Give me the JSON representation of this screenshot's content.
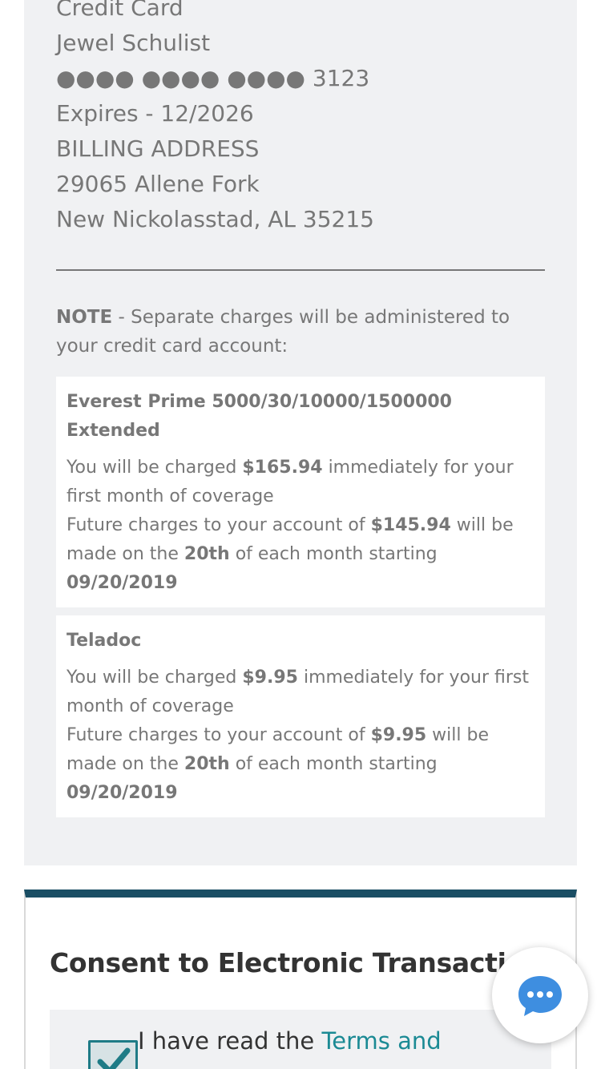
{
  "payment": {
    "method": "Credit Card",
    "name": "Jewel Schulist",
    "card_masked": "●●●● ●●●● ●●●● 3123",
    "expires": "Expires - 12/2026",
    "billing_header": "BILLING ADDRESS",
    "address_line1": "29065 Allene Fork",
    "address_line2": "New Nickolasstad, AL 35215"
  },
  "note": {
    "label": "NOTE",
    "text": " - Separate charges will be administered to your credit card account:"
  },
  "charges": [
    {
      "title": "Everest Prime 5000/30/10000/1500000 Extended",
      "prefix1": "You will be charged ",
      "amount_now": "$165.94",
      "suffix1": " immediately for your first month of coverage",
      "prefix2": "Future charges to your account of ",
      "amount_future": "$145.94",
      "mid2": " will be made on the ",
      "day": "20th",
      "suffix2": " of each month starting ",
      "start_date": "09/20/2019"
    },
    {
      "title": "Teladoc",
      "prefix1": "You will be charged ",
      "amount_now": "$9.95",
      "suffix1": " immediately for your first month of coverage",
      "prefix2": "Future charges to your account of ",
      "amount_future": "$9.95",
      "mid2": " will be made on the ",
      "day": "20th",
      "suffix2": " of each month starting ",
      "start_date": "09/20/2019"
    }
  ],
  "consent": {
    "title": "Consent to Electronic Transactions",
    "checkbox_checked": true,
    "checkbox_text": "I have read the ",
    "link_text": "Terms and"
  },
  "chat": {
    "icon": "chat-bubble-icon"
  },
  "colors": {
    "accent": "#1b8a94",
    "header_bar": "#1a4e64",
    "panel_bg": "#f0f1f3"
  }
}
